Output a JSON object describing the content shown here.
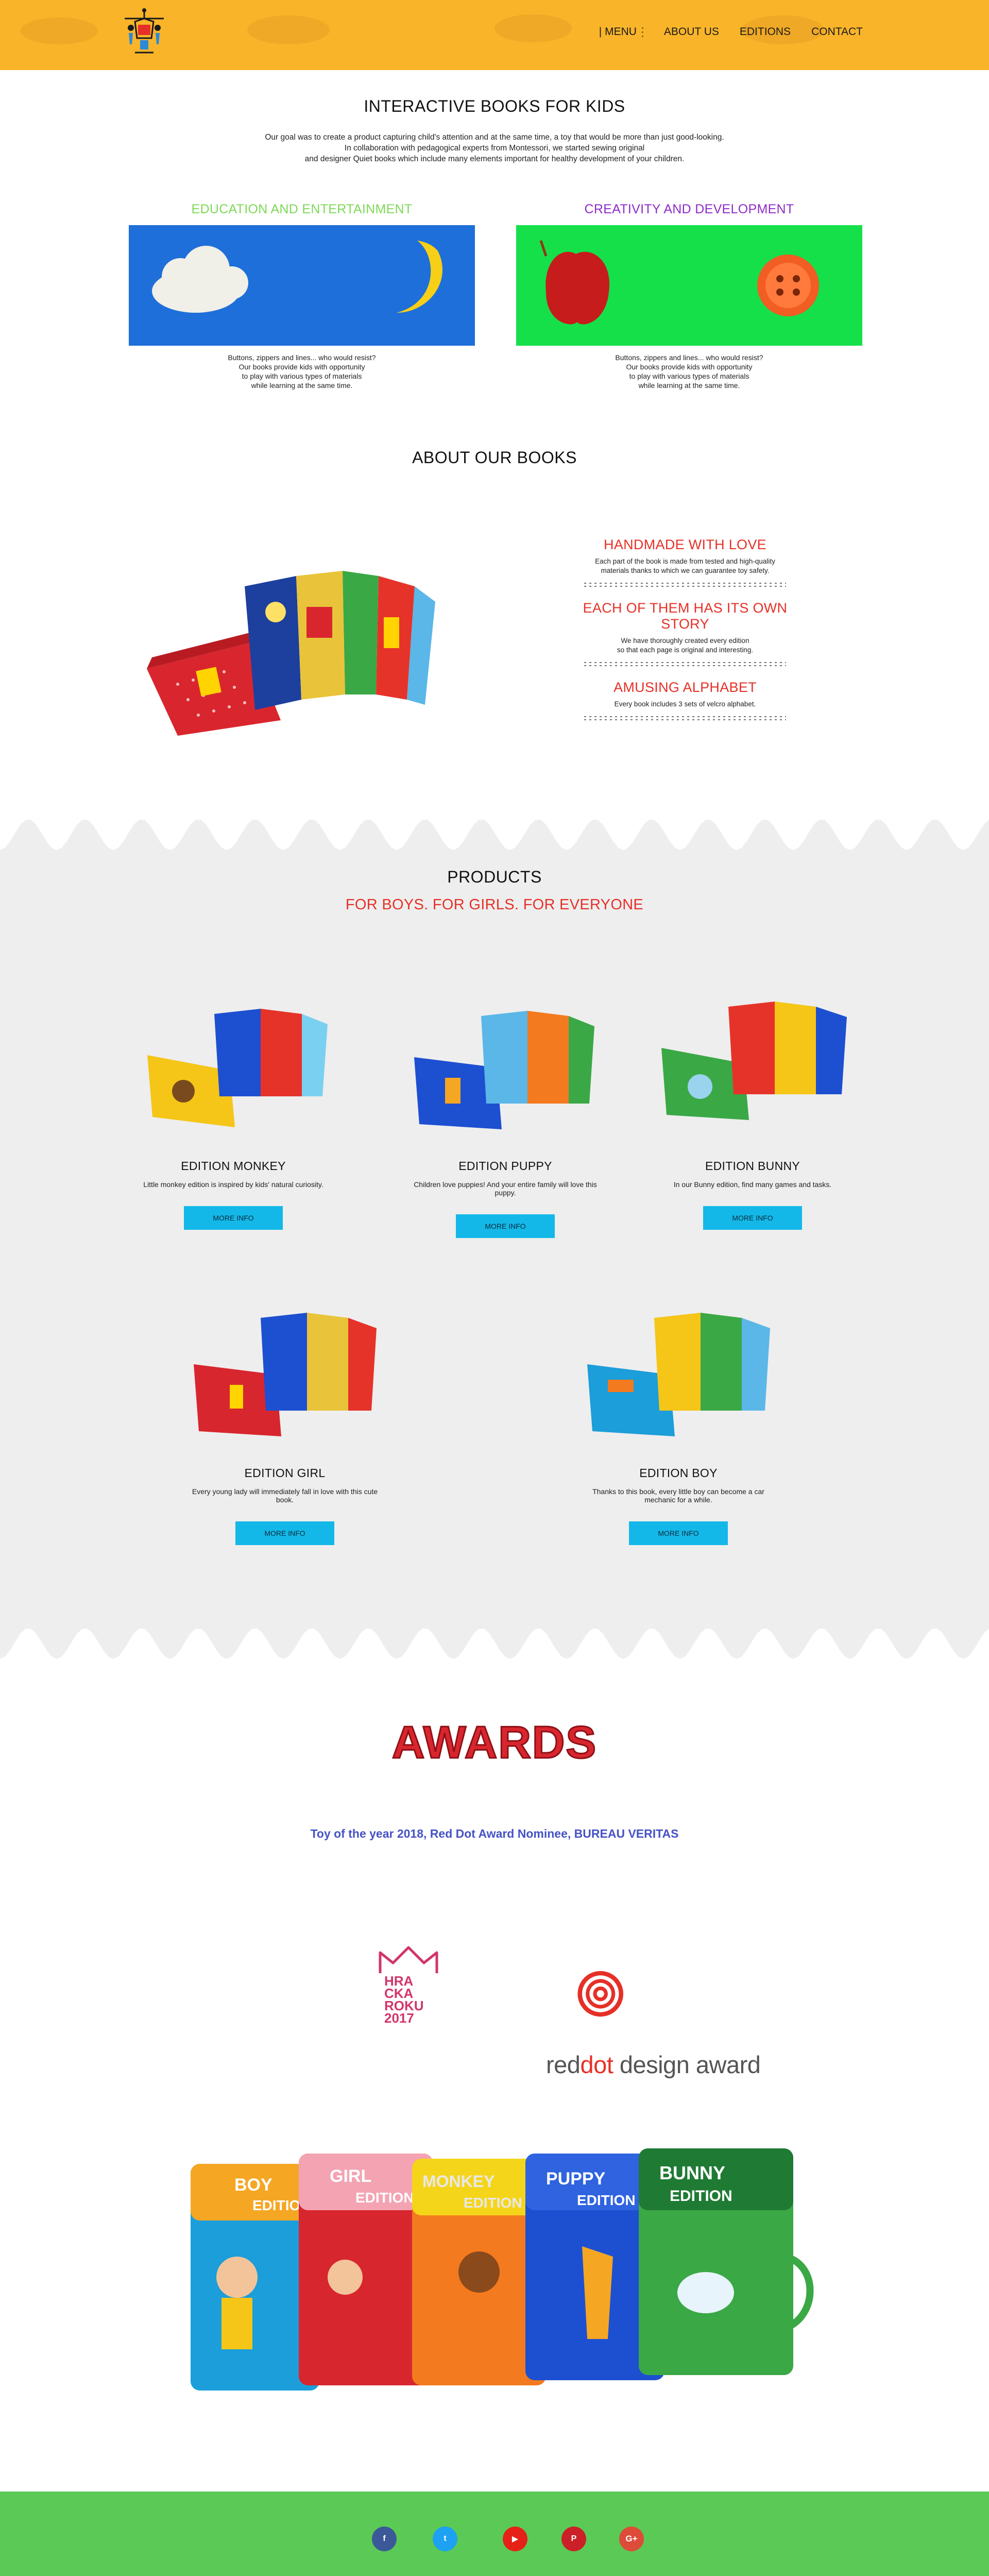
{
  "header": {
    "nav": {
      "menu_label": "| MENU",
      "about_label": "ABOUT US",
      "editions_label": "EDITIONS",
      "contact_label": "CONTACT"
    },
    "colors": {
      "background": "#f9b42a"
    }
  },
  "intro": {
    "title": "INTERACTIVE BOOKS FOR KIDS",
    "lines": [
      "Our goal was to create a product capturing child's attention and at the same time, a toy that would be more than just good-looking.",
      "In collaboration with pedagogical experts from Montessori, we started sewing original",
      "and designer Quiet books which include many elements important for healthy development of your children."
    ],
    "features": [
      {
        "title": "EDUCATION AND ENTERTAINMENT",
        "title_color": "#7ed957",
        "image_bg": "#1e6fd9",
        "desc_lines": [
          "Buttons, zippers and lines... who would resist?",
          "Our books provide kids with opportunity",
          "to play with various types of materials",
          "while learning at the same time."
        ]
      },
      {
        "title": "CREATIVITY AND DEVELOPMENT",
        "title_color": "#8e2cc9",
        "image_bg": "#15e04a",
        "desc_lines": [
          "Buttons, zippers and lines... who would resist?",
          "Our books provide kids with opportunity",
          "to play with various types of materials",
          "while learning at the same time."
        ]
      }
    ]
  },
  "about": {
    "title": "ABOUT OUR BOOKS",
    "items": [
      {
        "title": "HANDMADE WITH LOVE",
        "lines": [
          "Each part of the book is made from tested and high-quality",
          "materials thanks to which we can guarantee toy safety."
        ]
      },
      {
        "title": "EACH OF THEM HAS ITS OWN STORY",
        "lines": [
          "We have thoroughly created every edition",
          "so that each page is original and interesting."
        ]
      },
      {
        "title": "AMUSING ALPHABET",
        "lines": [
          "Every book includes 3 sets of velcro alphabet."
        ]
      }
    ]
  },
  "products": {
    "title": "PRODUCTS",
    "subtitle": "FOR BOYS. FOR GIRLS. FOR EVERYONE",
    "button_label": "MORE INFO",
    "items": [
      {
        "name": "EDITION MONKEY",
        "desc": "Little monkey edition is inspired by kids' natural curiosity.",
        "cover": "#f5c518"
      },
      {
        "name": "EDITION PUPPY",
        "desc": "Children love puppies! And your entire family will love this puppy.",
        "cover": "#1d4fd1"
      },
      {
        "name": "EDITION BUNNY",
        "desc": "In our Bunny edition, find many games and tasks.",
        "cover": "#3aa845"
      },
      {
        "name": "EDITION GIRL",
        "desc": "Every young lady will immediately fall in love with this cute book.",
        "cover": "#d8262e"
      },
      {
        "name": "EDITION BOY",
        "desc": "Thanks to this book, every little boy can become a car mechanic for a while.",
        "cover": "#1b9ed9"
      }
    ]
  },
  "awards": {
    "title": "AWARDS",
    "subtitle": "Toy of the year 2018, Red Dot Award Nominee, BUREAU VERITAS",
    "hracka": {
      "l1": "HRA",
      "l2": "CKA",
      "l3": "ROKU",
      "l4": "2017"
    },
    "reddot": {
      "part1": "red",
      "part2": "dot",
      "part3": " design award"
    },
    "book_labels": [
      {
        "t1": "BOY",
        "t2": "EDITION"
      },
      {
        "t1": "GIRL",
        "t2": "EDITION"
      },
      {
        "t1": "MONKEY",
        "t2": "EDITION"
      },
      {
        "t1": "PUPPY",
        "t2": "EDITION"
      },
      {
        "t1": "BUNNY",
        "t2": "EDITION"
      }
    ]
  },
  "footer": {
    "social": [
      {
        "icon": "facebook-icon",
        "glyph": "f",
        "color": "#3b5998"
      },
      {
        "icon": "twitter-icon",
        "glyph": "t",
        "color": "#1da1f2"
      },
      {
        "icon": "youtube-icon",
        "glyph": "▶",
        "color": "#e62117"
      },
      {
        "icon": "pinterest-icon",
        "glyph": "P",
        "color": "#cb2027"
      },
      {
        "icon": "google-plus-icon",
        "glyph": "G+",
        "color": "#dd4b39"
      }
    ],
    "colors": {
      "background": "#5bc955"
    }
  }
}
